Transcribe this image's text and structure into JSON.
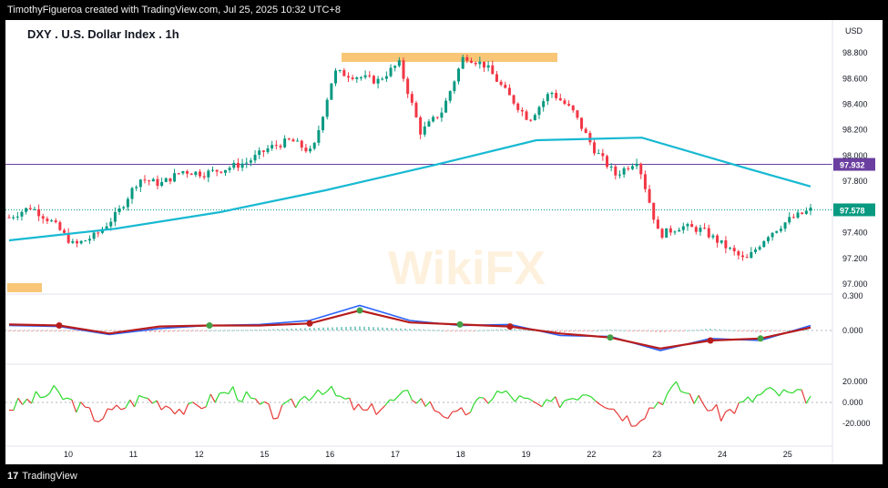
{
  "header": {
    "caption": "TimothyFigueroa created with TradingView.com, Jul 25, 2025 10:32 UTC+8"
  },
  "footer": {
    "brand": "TradingView",
    "logo_glyph": "17"
  },
  "watermark": {
    "text": "WikiFX"
  },
  "colors": {
    "up": "#089981",
    "down": "#f23645",
    "ma": "#17b9d2",
    "hline": "#6a3fa0",
    "current": "#089981",
    "highlight": "#f7b34a",
    "macd_fast": "#2962ff",
    "macd_slow": "#b71c1c",
    "macd_dot_green": "#43a047",
    "macd_dot_red": "#b71c1c",
    "osc_up": "#2bd92b",
    "osc_down": "#e53935"
  },
  "chart_data": {
    "type": "candlestick",
    "title": "DXY . U.S. Dollar Index . 1h",
    "currency": "USD",
    "price_axis": {
      "ticks": [
        "98.800",
        "98.600",
        "98.400",
        "98.200",
        "98.000",
        "97.800",
        "97.400",
        "97.200",
        "97.000"
      ],
      "range": [
        97.0,
        98.85
      ]
    },
    "x_labels": [
      "10",
      "11",
      "12",
      "15",
      "16",
      "17",
      "18",
      "19",
      "22",
      "23",
      "24",
      "25"
    ],
    "price_series": [
      {
        "t": "10",
        "price": 97.52
      },
      {
        "t": "10",
        "price": 97.6
      },
      {
        "t": "10",
        "price": 97.48
      },
      {
        "t": "10",
        "price": 97.3
      },
      {
        "t": "10",
        "price": 97.38
      },
      {
        "t": "11",
        "price": 97.55
      },
      {
        "t": "11",
        "price": 97.82
      },
      {
        "t": "11",
        "price": 97.78
      },
      {
        "t": "11",
        "price": 97.88
      },
      {
        "t": "12",
        "price": 97.86
      },
      {
        "t": "12",
        "price": 97.9
      },
      {
        "t": "12",
        "price": 97.95
      },
      {
        "t": "15",
        "price": 98.06
      },
      {
        "t": "15",
        "price": 98.12
      },
      {
        "t": "15",
        "price": 98.02
      },
      {
        "t": "16",
        "price": 98.65
      },
      {
        "t": "16",
        "price": 98.62
      },
      {
        "t": "16",
        "price": 98.58
      },
      {
        "t": "17",
        "price": 98.72
      },
      {
        "t": "17",
        "price": 98.18
      },
      {
        "t": "17",
        "price": 98.35
      },
      {
        "t": "18",
        "price": 98.78
      },
      {
        "t": "18",
        "price": 98.7
      },
      {
        "t": "18",
        "price": 98.48
      },
      {
        "t": "19",
        "price": 98.28
      },
      {
        "t": "19",
        "price": 98.5
      },
      {
        "t": "19",
        "price": 98.35
      },
      {
        "t": "22",
        "price": 98.05
      },
      {
        "t": "22",
        "price": 97.85
      },
      {
        "t": "22",
        "price": 97.97
      },
      {
        "t": "23",
        "price": 97.38
      },
      {
        "t": "23",
        "price": 97.45
      },
      {
        "t": "23",
        "price": 97.42
      },
      {
        "t": "24",
        "price": 97.3
      },
      {
        "t": "24",
        "price": 97.18
      },
      {
        "t": "24",
        "price": 97.38
      },
      {
        "t": "25",
        "price": 97.5
      },
      {
        "t": "25",
        "price": 97.578
      }
    ],
    "moving_average": {
      "x_index": [
        0,
        5,
        10,
        15,
        20,
        25,
        30,
        35,
        38
      ],
      "values": [
        97.34,
        97.43,
        97.56,
        97.73,
        97.92,
        98.12,
        98.14,
        97.9,
        97.76
      ]
    },
    "horizontal_line": {
      "value": "97.932",
      "level": 97.932
    },
    "current_price": {
      "value": "97.578",
      "level": 97.578
    },
    "resistance_zone": {
      "label": ""
    },
    "macd": {
      "zero_label": "0.000",
      "top_tick": "0.300",
      "fast": [
        0.05,
        0.04,
        -0.04,
        0.02,
        0.05,
        0.06,
        0.1,
        0.25,
        0.1,
        0.05,
        0.06,
        -0.05,
        -0.06,
        -0.2,
        -0.08,
        -0.1,
        0.05
      ],
      "slow": [
        0.06,
        0.05,
        -0.03,
        0.04,
        0.05,
        0.05,
        0.07,
        0.2,
        0.08,
        0.06,
        0.04,
        -0.03,
        -0.07,
        -0.18,
        -0.1,
        -0.08,
        0.03
      ]
    },
    "oscillator": {
      "ticks": [
        "20.000",
        "0.000",
        "-20.000"
      ],
      "values": [
        -5,
        10,
        -15,
        5,
        -8,
        12,
        -12,
        15,
        -10,
        8,
        -15,
        10,
        -5,
        12,
        -18,
        15,
        -12,
        10,
        5
      ]
    }
  }
}
